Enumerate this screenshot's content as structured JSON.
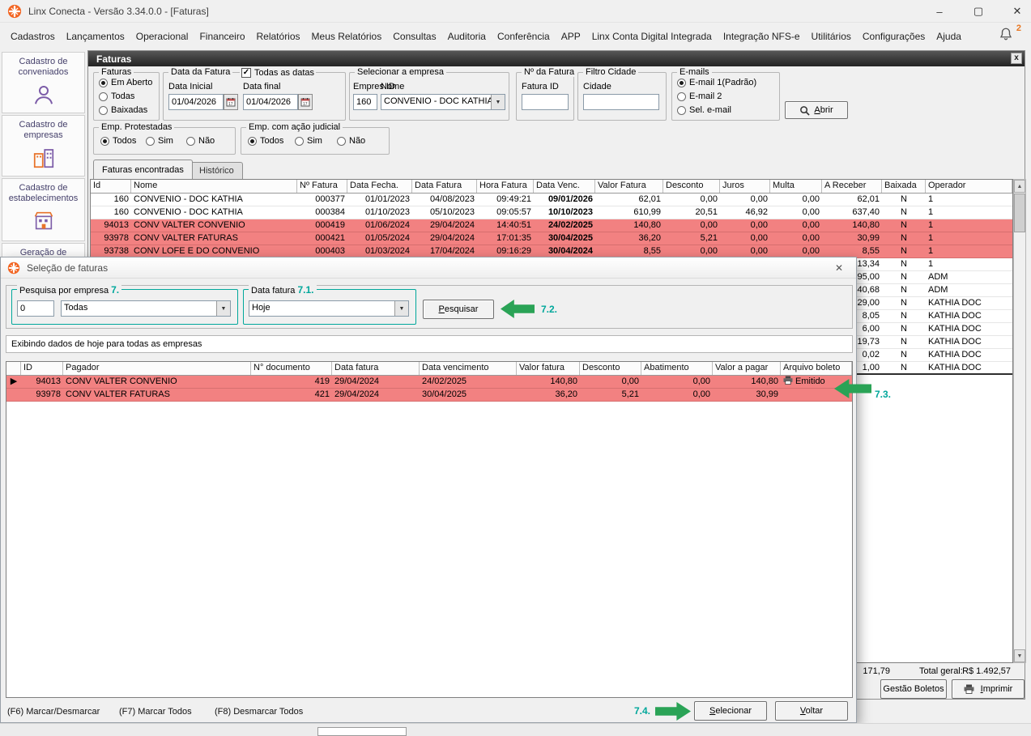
{
  "icons": {
    "minimize": "–",
    "maximize": "▢",
    "close": "✕",
    "panel_close": "x",
    "dropdown_arrow": "▼",
    "scroll_up": "▲",
    "scroll_down": "▼",
    "row_selector": "▶",
    "checkmark": "✓"
  },
  "titlebar": {
    "title": "Linx Conecta - Versão 3.34.0.0 - [Faturas]"
  },
  "menubar": {
    "items": [
      "Cadastros",
      "Lançamentos",
      "Operacional",
      "Financeiro",
      "Relatórios",
      "Meus Relatórios",
      "Consultas",
      "Auditoria",
      "Conferência",
      "APP",
      "Linx Conta Digital Integrada",
      "Integração NFS-e",
      "Utilitários",
      "Configurações",
      "Ajuda"
    ],
    "notification_count": "2"
  },
  "sidebar": {
    "items": [
      {
        "label": "Cadastro de conveniados"
      },
      {
        "label": "Cadastro de empresas"
      },
      {
        "label": "Cadastro de estabelecimentos"
      },
      {
        "label": "Geração de"
      }
    ]
  },
  "panel": {
    "title": "Faturas",
    "filters": {
      "faturas": {
        "legend": "Faturas",
        "options": [
          {
            "label": "Em Aberto",
            "selected": true
          },
          {
            "label": "Todas",
            "selected": false
          },
          {
            "label": "Baixadas",
            "selected": false
          }
        ]
      },
      "data_fatura": {
        "legend": "Data da Fatura",
        "todas_datas_label": "Todas as datas",
        "todas_datas_checked": true,
        "inicial_label": "Data Inicial",
        "inicial_value": "01/04/2026",
        "final_label": "Data final",
        "final_value": "01/04/2026"
      },
      "empresa": {
        "legend": "Selecionar a empresa",
        "id_label": "Empres ID",
        "id_value": "160",
        "nome_label": "Nome",
        "nome_value": "CONVENIO - DOC KATHIA"
      },
      "num_fatura": {
        "legend": "Nº da Fatura",
        "id_label": "Fatura ID",
        "id_value": ""
      },
      "cidade": {
        "legend": "Filtro Cidade",
        "label": "Cidade",
        "value": ""
      },
      "emails": {
        "legend": "E-mails",
        "options": [
          {
            "label": "E-mail 1(Padrão)",
            "selected": true
          },
          {
            "label": "E-mail 2",
            "selected": false
          },
          {
            "label": "Sel. e-mail",
            "selected": false
          }
        ]
      },
      "abrir_key": "A",
      "abrir_rest": "brir",
      "protestadas": {
        "legend": "Emp. Protestadas",
        "options": [
          {
            "label": "Todos",
            "selected": true
          },
          {
            "label": "Sim",
            "selected": false
          },
          {
            "label": "Não",
            "selected": false
          }
        ]
      },
      "judicial": {
        "legend": "Emp. com ação judicial",
        "options": [
          {
            "label": "Todos",
            "selected": true
          },
          {
            "label": "Sim",
            "selected": false
          },
          {
            "label": "Não",
            "selected": false
          }
        ]
      }
    },
    "tabs": [
      {
        "label": "Faturas encontradas",
        "active": true
      },
      {
        "label": "Histórico",
        "active": false
      }
    ],
    "table": {
      "columns": [
        "Id",
        "Nome",
        "Nº Fatura",
        "Data Fecha.",
        "Data Fatura",
        "Hora Fatura",
        "Data Venc.",
        "Valor Fatura",
        "Desconto",
        "Juros",
        "Multa",
        "A Receber",
        "Baixada",
        "Operador"
      ],
      "rows": [
        {
          "id": "160",
          "nome": "CONVENIO - DOC KATHIA",
          "fatura": "000377",
          "fecha": "01/01/2023",
          "data": "04/08/2023",
          "hora": "09:49:21",
          "venc": "09/01/2026",
          "valor": "62,01",
          "desconto": "0,00",
          "juros": "0,00",
          "multa": "0,00",
          "receber": "62,01",
          "baixada": "N",
          "operador": "1",
          "highlight": false
        },
        {
          "id": "160",
          "nome": "CONVENIO - DOC KATHIA",
          "fatura": "000384",
          "fecha": "01/10/2023",
          "data": "05/10/2023",
          "hora": "09:05:57",
          "venc": "10/10/2023",
          "valor": "610,99",
          "desconto": "20,51",
          "juros": "46,92",
          "multa": "0,00",
          "receber": "637,40",
          "baixada": "N",
          "operador": "1",
          "highlight": false
        },
        {
          "id": "94013",
          "nome": "CONV VALTER CONVENIO",
          "fatura": "000419",
          "fecha": "01/06/2024",
          "data": "29/04/2024",
          "hora": "14:40:51",
          "venc": "24/02/2025",
          "valor": "140,80",
          "desconto": "0,00",
          "juros": "0,00",
          "multa": "0,00",
          "receber": "140,80",
          "baixada": "N",
          "operador": "1",
          "highlight": true
        },
        {
          "id": "93978",
          "nome": "CONV VALTER FATURAS",
          "fatura": "000421",
          "fecha": "01/05/2024",
          "data": "29/04/2024",
          "hora": "17:01:35",
          "venc": "30/04/2025",
          "valor": "36,20",
          "desconto": "5,21",
          "juros": "0,00",
          "multa": "0,00",
          "receber": "30,99",
          "baixada": "N",
          "operador": "1",
          "highlight": true
        },
        {
          "id": "93738",
          "nome": "CONV LOFE E DO CONVENIO",
          "fatura": "000403",
          "fecha": "01/03/2024",
          "data": "17/04/2024",
          "hora": "09:16:29",
          "venc": "30/04/2024",
          "valor": "8,55",
          "desconto": "0,00",
          "juros": "0,00",
          "multa": "0,00",
          "receber": "8,55",
          "baixada": "N",
          "operador": "1",
          "highlight": true
        },
        {
          "id": "",
          "nome": "",
          "fatura": "",
          "fecha": "",
          "data": "",
          "hora": "",
          "venc": "",
          "valor": "",
          "desconto": "",
          "juros": "",
          "multa": "",
          "receber": "13,34",
          "baixada": "N",
          "operador": "1",
          "highlight": false
        },
        {
          "id": "",
          "nome": "",
          "fatura": "",
          "fecha": "",
          "data": "",
          "hora": "",
          "venc": "",
          "valor": "",
          "desconto": "",
          "juros": "",
          "multa": "",
          "receber": "95,00",
          "baixada": "N",
          "operador": "ADM",
          "highlight": false
        },
        {
          "id": "",
          "nome": "",
          "fatura": "",
          "fecha": "",
          "data": "",
          "hora": "",
          "venc": "",
          "valor": "",
          "desconto": "",
          "juros": "",
          "multa": "",
          "receber": "440,68",
          "baixada": "N",
          "operador": "ADM",
          "highlight": false
        },
        {
          "id": "",
          "nome": "",
          "fatura": "",
          "fecha": "",
          "data": "",
          "hora": "",
          "venc": "",
          "valor": "",
          "desconto": "",
          "juros": "",
          "multa": "",
          "receber": "29,00",
          "baixada": "N",
          "operador": "KATHIA DOC",
          "highlight": false
        },
        {
          "id": "",
          "nome": "",
          "fatura": "",
          "fecha": "",
          "data": "",
          "hora": "",
          "venc": "",
          "valor": "",
          "desconto": "",
          "juros": "",
          "multa": "",
          "receber": "8,05",
          "baixada": "N",
          "operador": "KATHIA DOC",
          "highlight": false
        },
        {
          "id": "",
          "nome": "",
          "fatura": "",
          "fecha": "",
          "data": "",
          "hora": "",
          "venc": "",
          "valor": "",
          "desconto": "",
          "juros": "",
          "multa": "",
          "receber": "6,00",
          "baixada": "N",
          "operador": "KATHIA DOC",
          "highlight": false
        },
        {
          "id": "",
          "nome": "",
          "fatura": "",
          "fecha": "",
          "data": "",
          "hora": "",
          "venc": "",
          "valor": "",
          "desconto": "",
          "juros": "",
          "multa": "",
          "receber": "19,73",
          "baixada": "N",
          "operador": "KATHIA DOC",
          "highlight": false
        },
        {
          "id": "",
          "nome": "",
          "fatura": "",
          "fecha": "",
          "data": "",
          "hora": "",
          "venc": "",
          "valor": "",
          "desconto": "",
          "juros": "",
          "multa": "",
          "receber": "0,02",
          "baixada": "N",
          "operador": "KATHIA DOC",
          "highlight": false
        },
        {
          "id": "",
          "nome": "",
          "fatura": "",
          "fecha": "",
          "data": "",
          "hora": "",
          "venc": "",
          "valor": "",
          "desconto": "",
          "juros": "",
          "multa": "",
          "receber": "1,00",
          "baixada": "N",
          "operador": "KATHIA DOC",
          "highlight": false
        }
      ]
    },
    "totals": {
      "receber_total": "171,79",
      "label": "Total geral:",
      "value": "R$ 1.492,57"
    },
    "gestao_boletos_label": "Gestão Boletos",
    "imprimir_key": "I",
    "imprimir_rest": "mprimir"
  },
  "dialog": {
    "title": "Seleção de faturas",
    "pesquisa_empresa": {
      "legend": "Pesquisa por empresa",
      "step": "7.",
      "input_value": "0",
      "select_value": "Todas"
    },
    "data_fatura": {
      "legend": "Data fatura",
      "step": "7.1.",
      "select_value": "Hoje"
    },
    "pesquisar_key": "P",
    "pesquisar_rest": "esquisar",
    "steps": {
      "s72": "7.2.",
      "s73": "7.3.",
      "s74": "7.4."
    },
    "status": "Exibindo dados de hoje para todas as empresas",
    "table": {
      "columns": [
        "ID",
        "Pagador",
        "N° documento",
        "Data fatura",
        "Data vencimento",
        "Valor fatura",
        "Desconto",
        "Abatimento",
        "Valor a pagar",
        "Arquivo boleto"
      ],
      "rows": [
        {
          "selected": true,
          "id": "94013",
          "pagador": "CONV VALTER CONVENIO",
          "doc": "419",
          "data": "29/04/2024",
          "venc": "24/02/2025",
          "valor": "140,80",
          "desconto": "0,00",
          "abat": "0,00",
          "pagar": "140,80",
          "boleto": "Emitido"
        },
        {
          "selected": false,
          "id": "93978",
          "pagador": "CONV VALTER FATURAS",
          "doc": "421",
          "data": "29/04/2024",
          "venc": "30/04/2025",
          "valor": "36,20",
          "desconto": "5,21",
          "abat": "0,00",
          "pagar": "30,99",
          "boleto": ""
        }
      ]
    },
    "footer": {
      "f6": "(F6) Marcar/Desmarcar",
      "f7": "(F7) Marcar Todos",
      "f8": "(F8) Desmarcar Todos",
      "selecionar_key": "S",
      "selecionar_rest": "elecionar",
      "voltar_key": "V",
      "voltar_rest": "oltar"
    }
  }
}
